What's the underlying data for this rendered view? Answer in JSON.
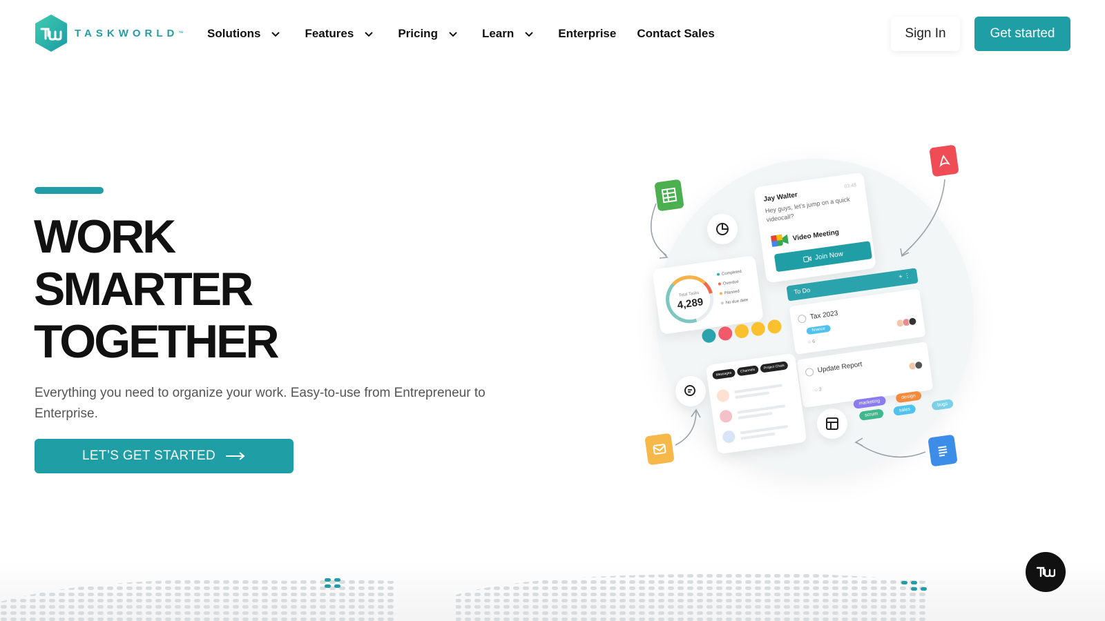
{
  "brand": {
    "name": "TASKWORLD",
    "tm": "™",
    "color": "#229ca7"
  },
  "nav": {
    "items": [
      {
        "label": "Solutions",
        "dropdown": true
      },
      {
        "label": "Features",
        "dropdown": true
      },
      {
        "label": "Pricing",
        "dropdown": true
      },
      {
        "label": "Learn",
        "dropdown": true
      },
      {
        "label": "Enterprise",
        "dropdown": false
      },
      {
        "label": "Contact Sales",
        "dropdown": false
      }
    ],
    "sign_in": "Sign In",
    "get_started": "Get started"
  },
  "hero": {
    "headline": [
      "WORK",
      "SMARTER",
      "TOGETHER"
    ],
    "subtext": "Everything you need to organize your work. Easy-to-use from Entrepreneur to Enterprise.",
    "cta": "LET’S GET STARTED"
  },
  "illustration": {
    "chat": {
      "name": "Jay Walter",
      "time": "03:48",
      "message": "Hey guys, let's jump on a quick videocall?",
      "meeting": "Video Meeting",
      "join": "Join Now"
    },
    "stats": {
      "label": "Total Tasks",
      "value": "4,289",
      "legend": [
        "Completed",
        "Overdue",
        "Planned",
        "No due date"
      ],
      "legend_colors": [
        "#2fb4a8",
        "#f06a4a",
        "#f7b24a",
        "#cccccc"
      ]
    },
    "todo": {
      "header": "To Do",
      "items": [
        {
          "title": "Tax 2023",
          "tag": "finance",
          "count": "6"
        },
        {
          "title": "Update Report",
          "tag": "",
          "count": "2"
        }
      ]
    },
    "messages_tabs": [
      "Messages",
      "Channels",
      "Project Chats"
    ],
    "tags": [
      {
        "label": "marketing",
        "color": "#8a7cf0"
      },
      {
        "label": "design",
        "color": "#f58a3b"
      },
      {
        "label": "scrum",
        "color": "#3fb98c"
      },
      {
        "label": "sales",
        "color": "#4fc3ee"
      },
      {
        "label": "bugs",
        "color": "#7bd0e8"
      }
    ]
  },
  "colors": {
    "accent": "#1f9ea6",
    "dark": "#111111"
  }
}
